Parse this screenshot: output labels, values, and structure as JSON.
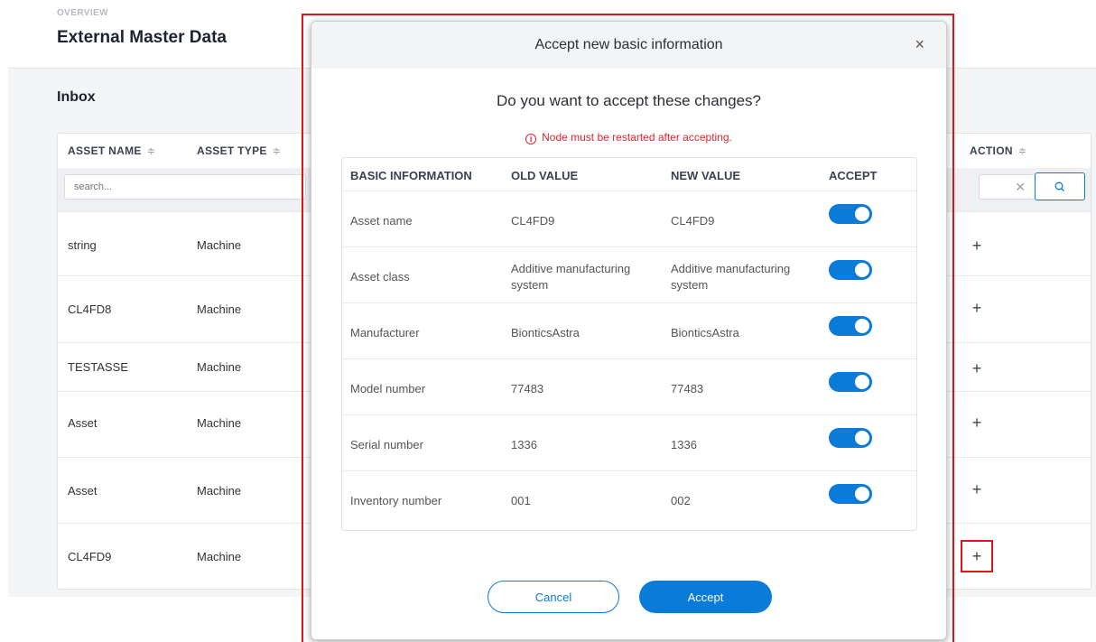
{
  "page": {
    "overline": "OVERVIEW",
    "title": "External Master Data",
    "section_title": "Inbox"
  },
  "inbox": {
    "columns": {
      "asset_name": "ASSET NAME",
      "asset_type": "ASSET TYPE",
      "action": "ACTION"
    },
    "search_placeholder": "search...",
    "rows": [
      {
        "name": "string",
        "type": "Machine",
        "action": "+"
      },
      {
        "name": "CL4FD8",
        "type": "Machine",
        "action": "+"
      },
      {
        "name": "TESTASSE",
        "type": "Machine",
        "action": "+"
      },
      {
        "name": "Asset",
        "type": "Machine",
        "action": "+"
      },
      {
        "name": "Asset",
        "type": "Machine",
        "action": "+"
      },
      {
        "name": "CL4FD9",
        "type": "Machine",
        "action": "+"
      }
    ]
  },
  "modal": {
    "title": "Accept new basic information",
    "close": "×",
    "question": "Do you want to accept these changes?",
    "warning": "Node must be restarted after accepting.",
    "columns": {
      "basic_information": "BASIC INFORMATION",
      "old_value": "OLD VALUE",
      "new_value": "NEW VALUE",
      "accept": "ACCEPT"
    },
    "rows": [
      {
        "label": "Asset name",
        "old": "CL4FD9",
        "new": "CL4FD9",
        "accept": true
      },
      {
        "label": "Asset class",
        "old": "Additive manufacturing system",
        "new": "Additive manufacturing system",
        "accept": true
      },
      {
        "label": "Manufacturer",
        "old": "BionticsAstra",
        "new": "BionticsAstra",
        "accept": true
      },
      {
        "label": "Model number",
        "old": "77483",
        "new": "77483",
        "accept": true
      },
      {
        "label": "Serial number",
        "old": "1336",
        "new": "1336",
        "accept": true
      },
      {
        "label": "Inventory number",
        "old": "001",
        "new": "002",
        "accept": true
      }
    ],
    "cancel_label": "Cancel",
    "accept_label": "Accept"
  },
  "colors": {
    "accent": "#0a7bd8",
    "warning": "#e0262e",
    "highlight": "#e0141c"
  }
}
